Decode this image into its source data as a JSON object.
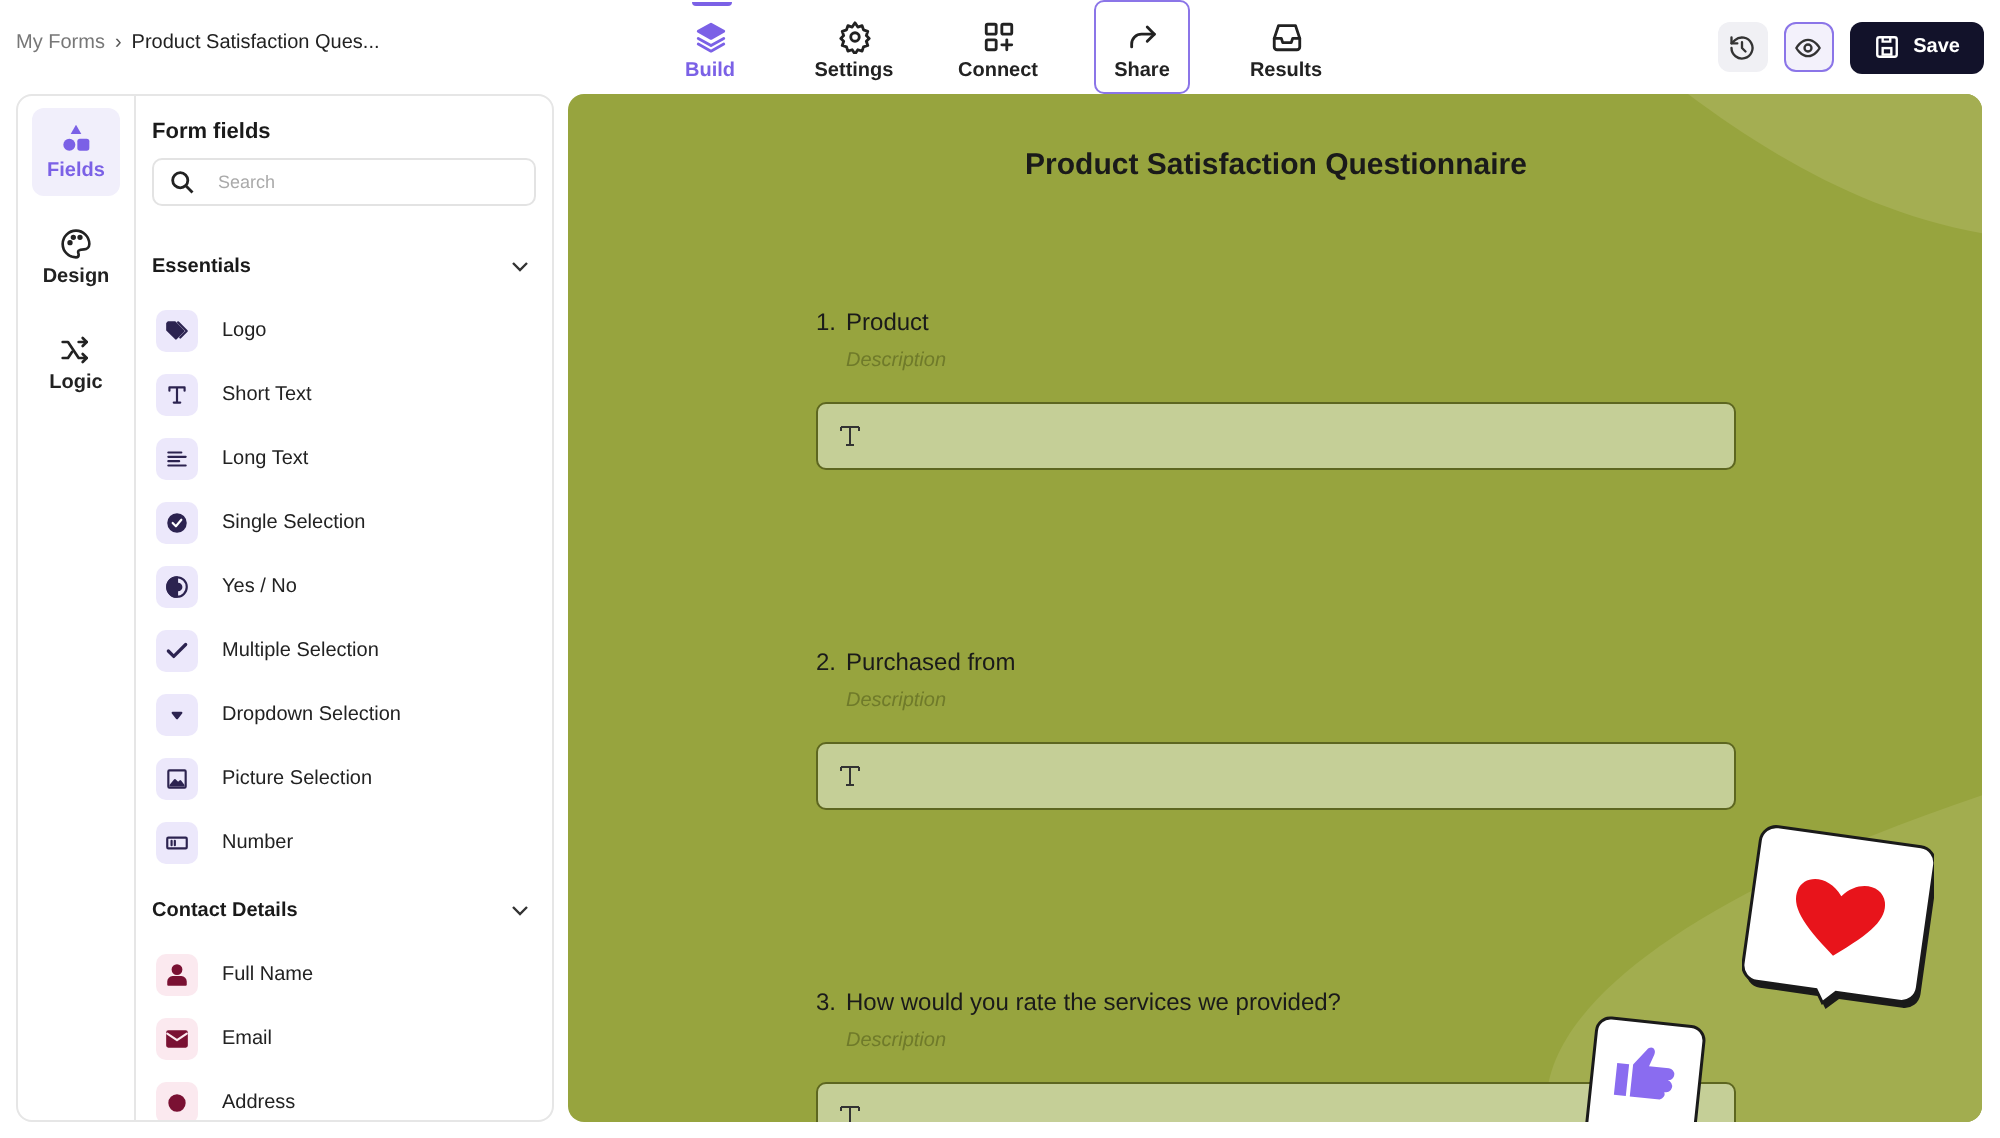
{
  "breadcrumb": {
    "parent": "My Forms",
    "separator": "›",
    "current": "Product Satisfaction Ques..."
  },
  "tabs": [
    {
      "label": "Build",
      "kind": "layers",
      "selected": true,
      "focused": false
    },
    {
      "label": "Settings",
      "kind": "gear",
      "selected": false,
      "focused": false
    },
    {
      "label": "Connect",
      "kind": "apps",
      "selected": false,
      "focused": false
    },
    {
      "label": "Share",
      "kind": "share",
      "selected": false,
      "focused": true
    },
    {
      "label": "Results",
      "kind": "inbox",
      "selected": false,
      "focused": false
    }
  ],
  "toolbar": [
    {
      "kind": "history",
      "focused": false
    },
    {
      "kind": "preview",
      "focused": true
    }
  ],
  "save_button": {
    "label": "Save"
  },
  "rail": [
    {
      "label": "Fields",
      "kind": "shapes",
      "selected": true
    },
    {
      "label": "Design",
      "kind": "palette",
      "selected": false
    },
    {
      "label": "Logic",
      "kind": "shuffle",
      "selected": false
    }
  ],
  "fields_panel": {
    "title": "Form fields",
    "search": {
      "placeholder": "Search"
    },
    "sections": [
      {
        "title": "Essentials",
        "expanded": true,
        "color": "#ece8fb",
        "items": [
          {
            "label": "Logo",
            "kind": "tags"
          },
          {
            "label": "Short Text",
            "kind": "text"
          },
          {
            "label": "Long Text",
            "kind": "lines"
          },
          {
            "label": "Single Selection",
            "kind": "radio"
          },
          {
            "label": "Yes / No",
            "kind": "toggle"
          },
          {
            "label": "Multiple Selection",
            "kind": "check"
          },
          {
            "label": "Dropdown Selection",
            "kind": "dropdown"
          },
          {
            "label": "Picture Selection",
            "kind": "picture"
          },
          {
            "label": "Number",
            "kind": "number"
          }
        ]
      },
      {
        "title": "Contact Details",
        "expanded": true,
        "color": "#fbe9ef",
        "items": [
          {
            "label": "Full Name",
            "kind": "person"
          },
          {
            "label": "Email",
            "kind": "mail"
          },
          {
            "label": "Address",
            "kind": "pin"
          }
        ]
      }
    ]
  },
  "form": {
    "title": "Product Satisfaction Questionnaire",
    "questions": [
      {
        "number": "1.",
        "title": "Product",
        "description": "Description"
      },
      {
        "number": "2.",
        "title": "Purchased from",
        "description": "Description"
      },
      {
        "number": "3.",
        "title": "How would you rate the services we provided?",
        "description": "Description"
      }
    ]
  }
}
